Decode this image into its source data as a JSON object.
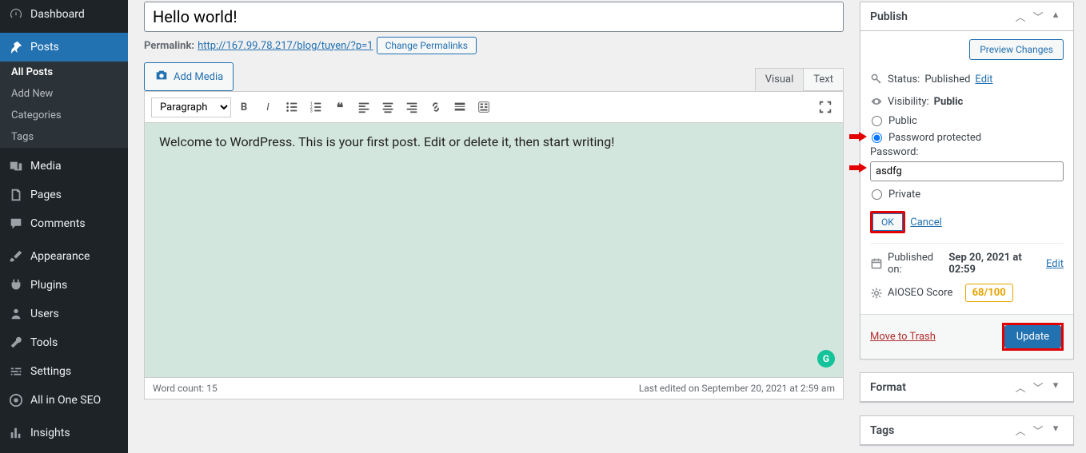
{
  "sidebar": {
    "items": [
      {
        "label": "Dashboard"
      },
      {
        "label": "Posts"
      },
      {
        "label": "Media"
      },
      {
        "label": "Pages"
      },
      {
        "label": "Comments"
      },
      {
        "label": "Appearance"
      },
      {
        "label": "Plugins"
      },
      {
        "label": "Users"
      },
      {
        "label": "Tools"
      },
      {
        "label": "Settings"
      },
      {
        "label": "All in One SEO"
      },
      {
        "label": "Insights"
      }
    ],
    "posts_submenu": [
      "All Posts",
      "Add New",
      "Categories",
      "Tags"
    ]
  },
  "editor": {
    "title_value": "Hello world!",
    "permalink_label": "Permalink:",
    "permalink_url": "http://167.99.78.217/blog/tuyen/?p=1",
    "change_permalinks": "Change Permalinks",
    "add_media": "Add Media",
    "tabs": {
      "visual": "Visual",
      "text": "Text"
    },
    "format_select": "Paragraph",
    "body_text": "Welcome to WordPress. This is your first post. Edit or delete it, then start writing!",
    "word_count_label": "Word count: 15",
    "last_edited": "Last edited on September 20, 2021 at 2:59 am"
  },
  "publish": {
    "title": "Publish",
    "preview_btn": "Preview Changes",
    "status_label": "Status:",
    "status_value": "Published",
    "edit": "Edit",
    "visibility_label": "Visibility:",
    "visibility_value": "Public",
    "opt_public": "Public",
    "opt_password": "Password protected",
    "password_label": "Password:",
    "password_value": "asdfg",
    "opt_private": "Private",
    "ok": "OK",
    "cancel": "Cancel",
    "published_on_label": "Published on:",
    "published_on_value": "Sep 20, 2021 at 02:59",
    "aioseo_label": "AIOSEO Score",
    "aioseo_score": "68/100",
    "trash": "Move to Trash",
    "update": "Update"
  },
  "format_box": {
    "title": "Format"
  },
  "tags_box": {
    "title": "Tags"
  }
}
